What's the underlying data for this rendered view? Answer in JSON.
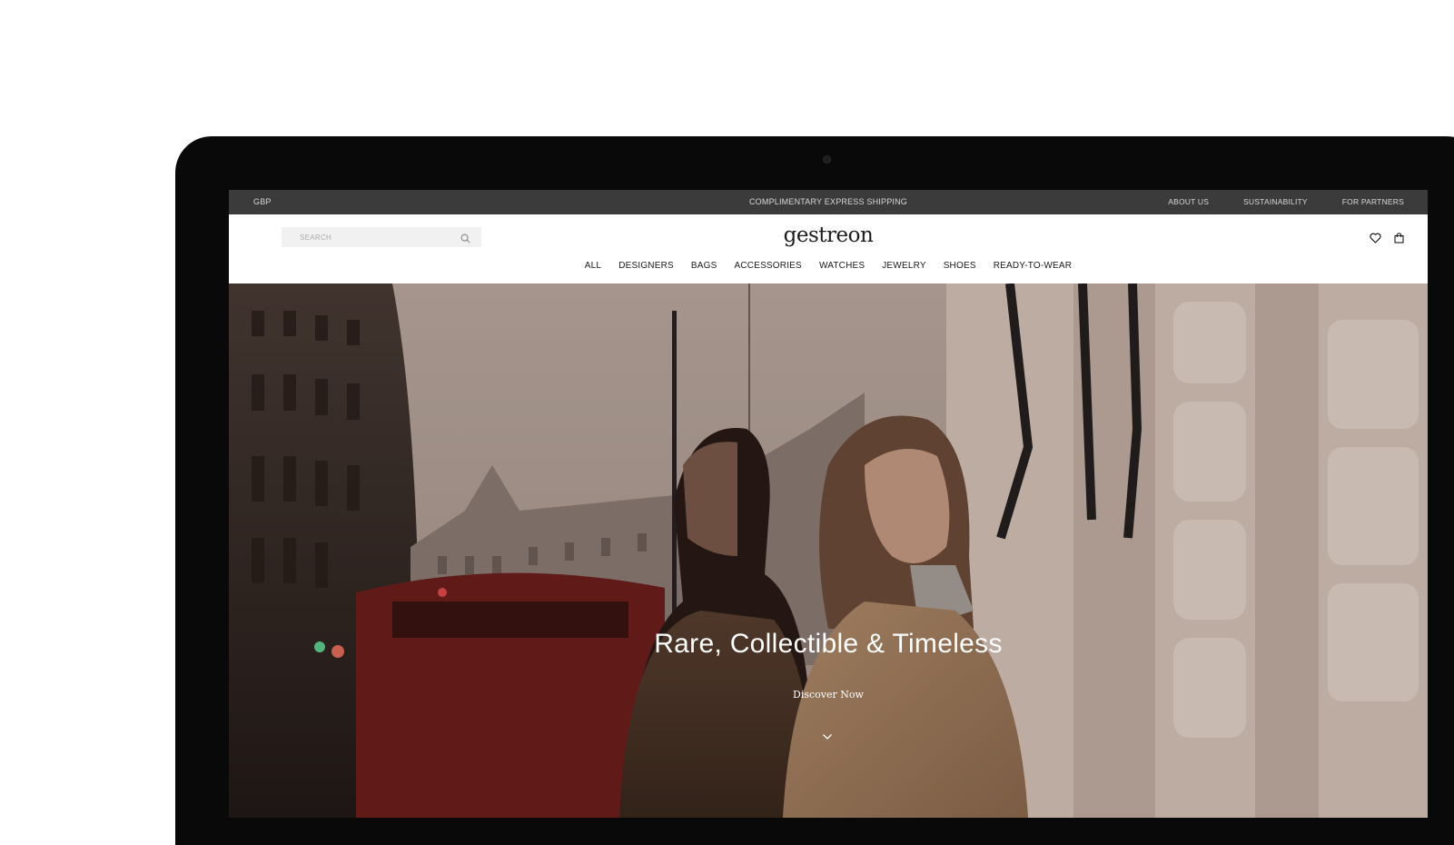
{
  "topbar": {
    "currency": "GBP",
    "shipping": "COMPLIMENTARY EXPRESS SHIPPING",
    "links": [
      "ABOUT US",
      "SUSTAINABILITY",
      "FOR PARTNERS"
    ]
  },
  "search": {
    "placeholder": "SEARCH"
  },
  "logo": "gestreon",
  "nav": [
    "ALL",
    "DESIGNERS",
    "BAGS",
    "ACCESSORIES",
    "WATCHES",
    "JEWELRY",
    "SHOES",
    "READY-TO-WEAR"
  ],
  "hero": {
    "tagline": "Rare, Collectible & Timeless",
    "cta": "Discover Now"
  },
  "icons": {
    "search": "search-icon",
    "wishlist": "heart-icon",
    "bag": "shopping-bag-icon",
    "scroll": "chevron-down-icon"
  },
  "colors": {
    "topbar_bg": "#3b3b3b",
    "monitor_bezel": "#0a0909",
    "search_bg": "#f1f1f1"
  }
}
